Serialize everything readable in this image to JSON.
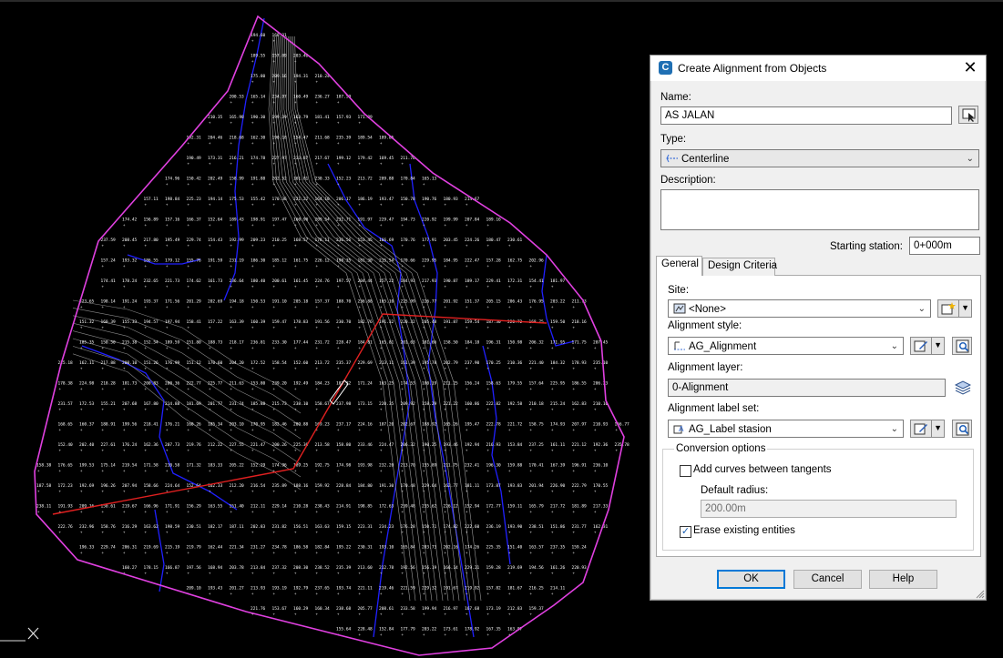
{
  "dialog": {
    "title": "Create Alignment from Objects",
    "close_symbol": "✕",
    "name_label": "Name:",
    "name_value": "AS JALAN",
    "type_label": "Type:",
    "type_value": "Centerline",
    "description_label": "Description:",
    "description_value": "",
    "starting_station_label": "Starting station:",
    "starting_station_value": "0+000m",
    "tabs": [
      {
        "label": "General",
        "active": true
      },
      {
        "label": "Design Criteria",
        "active": false
      }
    ],
    "site_label": "Site:",
    "site_value": "<None>",
    "alignment_style_label": "Alignment style:",
    "alignment_style_value": "AG_Alignment",
    "alignment_layer_label": "Alignment layer:",
    "alignment_layer_value": "0-Alignment",
    "alignment_label_set_label": "Alignment label set:",
    "alignment_label_set_value": "AG_Label stasion",
    "conversion_options_label": "Conversion options",
    "add_curves_label": "Add curves between tangents",
    "add_curves_checked": false,
    "default_radius_label": "Default radius:",
    "default_radius_value": "200.00m",
    "erase_label": "Erase existing entities",
    "erase_checked": true,
    "ok_label": "OK",
    "cancel_label": "Cancel",
    "help_label": "Help"
  },
  "colors": {
    "background": "#000000",
    "boundary": "#e040e0",
    "contour_major": "#2020ff",
    "contour_minor": "#9a9a9a",
    "alignment": "#e02020",
    "point_text": "#ffffff",
    "accent": "#0078d7"
  }
}
